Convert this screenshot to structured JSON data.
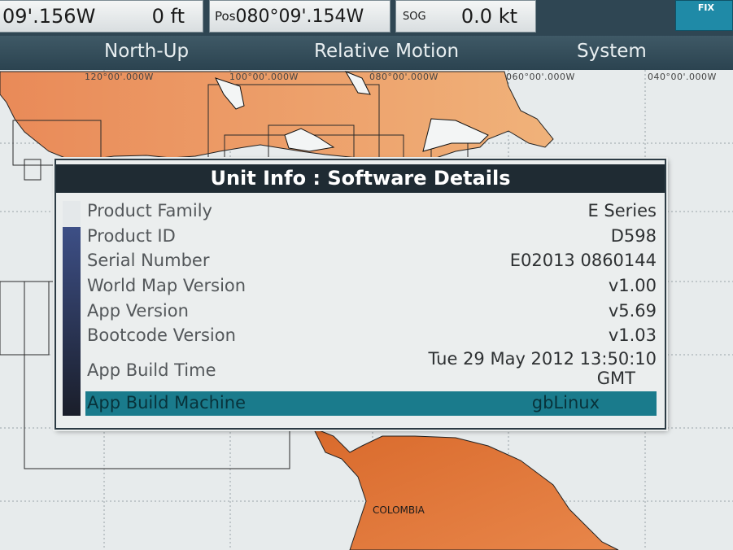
{
  "statusbar": {
    "lon_fragment": "09'.156W",
    "depth_value": "0 ft",
    "pos_label": "Pos",
    "pos_value": "080°09'.154W",
    "sog_label": "SOG",
    "sog_value": "0.0 kt",
    "fix_label": "FIX"
  },
  "modebar": {
    "orientation": "North-Up",
    "motion": "Relative Motion",
    "system": "System"
  },
  "chart": {
    "longitudes": [
      "120°00'.000W",
      "100°00'.000W",
      "080°00'.000W",
      "060°00'.000W",
      "040°00'.000W"
    ],
    "country_label": "COLOMBIA",
    "colors": {
      "land": "#e0833f",
      "sea": "#e7ebec",
      "dialog_header": "#1f2b33",
      "selection": "#1a7b8c"
    }
  },
  "dialog": {
    "title": "Unit Info : Software Details",
    "rows": [
      {
        "label": "Product Family",
        "value": "E Series"
      },
      {
        "label": "Product ID",
        "value": "D598"
      },
      {
        "label": "Serial Number",
        "value": "E02013 0860144"
      },
      {
        "label": "World Map Version",
        "value": "v1.00"
      },
      {
        "label": "App Version",
        "value": "v5.69"
      },
      {
        "label": "Bootcode Version",
        "value": "v1.03"
      },
      {
        "label": "App Build Time",
        "value": "Tue 29 May 2012 13:50:10",
        "value2": "GMT"
      },
      {
        "label": "App Build Machine",
        "value": "gbLinux"
      }
    ]
  }
}
